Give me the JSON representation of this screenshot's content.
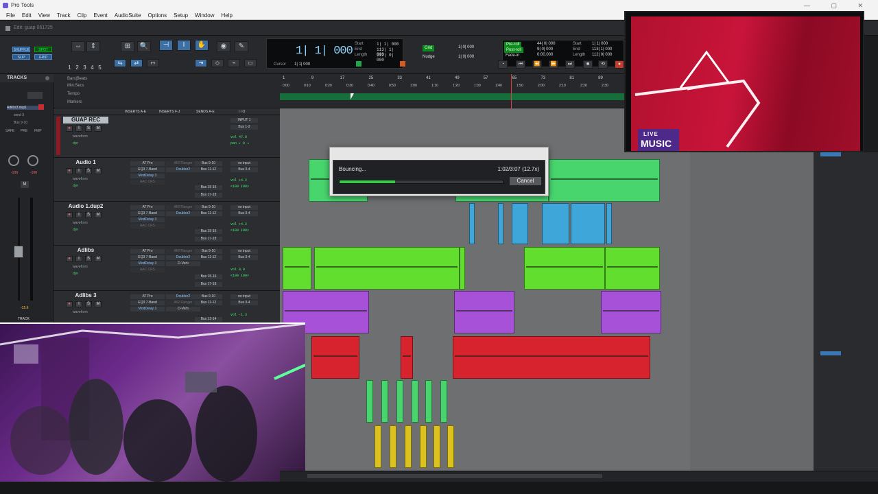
{
  "window": {
    "title": "Pro Tools",
    "doc_title": "Edit: guap 061725"
  },
  "menu": [
    "File",
    "Edit",
    "View",
    "Track",
    "Clip",
    "Event",
    "AudioSuite",
    "Options",
    "Setup",
    "Window",
    "Help"
  ],
  "toolbar": {
    "modes": [
      "SHUFFLE",
      "SPOT",
      "SLIP",
      "GRID"
    ],
    "zoom_presets": [
      "1",
      "2",
      "3",
      "4",
      "5"
    ],
    "counter": {
      "main": "1| 1| 000",
      "start_label": "Start",
      "end_label": "End",
      "length_label": "Length",
      "start": "1| 1| 000",
      "end": "113| 1| 000",
      "length": "112| 0| 000",
      "cursor_label": "Cursor",
      "cursor": "1| 1| 000"
    },
    "grid_label": "Grid",
    "grid": "1| 0| 000",
    "nudge_label": "Nudge",
    "nudge": "1| 0| 000",
    "preroll_label": "Pre-roll",
    "postroll_label": "Post-roll",
    "fadein_label": "Fade-in",
    "preroll": "44| 0| 000",
    "postroll": "9| 0| 000",
    "fadein": "0:00.000",
    "sel_start": "1| 1| 000",
    "sel_end": "113| 1| 000",
    "sel_length": "112| 0| 000"
  },
  "tracks_panel": {
    "header": "TRACKS",
    "item": "Adlibs3.dup1",
    "send": "send 3",
    "bus": "Bus 9-10",
    "safe": "SAFE",
    "pre": "PRE",
    "fmp": "FMP",
    "vol_a": "-100",
    "vol_b": "-100",
    "db": "-15.6",
    "track_btn": "TRACK",
    "m": "M"
  },
  "ruler": {
    "labels": [
      "Bars|Beats",
      "Min:Secs",
      "Tempo",
      "Markers"
    ],
    "bars": [
      "1",
      "9",
      "17",
      "25",
      "33",
      "41",
      "49",
      "57",
      "65",
      "73",
      "81",
      "89"
    ],
    "times": [
      "0:00",
      "0:10",
      "0:20",
      "0:30",
      "0:40",
      "0:50",
      "1:00",
      "1:10",
      "1:20",
      "1:30",
      "1:40",
      "1:50",
      "2:00",
      "2:10",
      "2:20",
      "2:30"
    ]
  },
  "mix_header": {
    "ins_ae": "INSERTS A-E",
    "ins_fj": "INSERTS F-J",
    "sends": "SENDS A-E",
    "io": "I / O"
  },
  "tracks": [
    {
      "name": "GUAP REC",
      "io_in": "INPUT 1",
      "io_out": "Bus 1-2",
      "vol": "vol  47.8",
      "pan": "pan ▸ 0 ◂",
      "view": "waveform",
      "dyn": "dyn"
    },
    {
      "name": "Audio 1",
      "inserts": [
        "AT Pro",
        "EQ3 7-Band",
        "ModDelay 3",
        "AAC CRS"
      ],
      "inserts2": [
        "AIR Flanger",
        "Doubler2"
      ],
      "sends": [
        "Bus 9-10",
        "Bus 11-12",
        "Bus 15-16",
        "Bus 17-18"
      ],
      "io_in": "no input",
      "io_out": "Bus 3-4",
      "vol": "vol  +4.2",
      "pan": "<100  100>"
    },
    {
      "name": "Audio 1.dup2",
      "inserts": [
        "AT Pro",
        "EQ3 7-Band",
        "ModDelay 3",
        "AAC CRS"
      ],
      "inserts2": [
        "AIR Flanger",
        "Doubler2"
      ],
      "sends": [
        "Bus 9-10",
        "Bus 11-12",
        "Bus 15-16",
        "Bus 17-18"
      ],
      "io_in": "no input",
      "io_out": "Bus 3-4",
      "vol": "vol  +4.2",
      "pan": "<100  100>"
    },
    {
      "name": "Adlibs",
      "inserts": [
        "AT Pro",
        "EQ3 7-Band",
        "ModDelay 3",
        "AAC CRS"
      ],
      "inserts2": [
        "AIR Flanger",
        "Doubler2",
        "D-Verb"
      ],
      "sends": [
        "Bus 9-10",
        "Bus 11-12",
        "Bus 15-16",
        "Bus 17-18"
      ],
      "io_in": "no input",
      "io_out": "Bus 3-4",
      "vol": "vol   0.0",
      "pan": "<100  100>"
    },
    {
      "name": "Adlibs 3",
      "inserts": [
        "AT Pro",
        "EQ3 7-Band",
        "ModDelay 3"
      ],
      "inserts2": [
        "Doubler2",
        "AIR Flanger",
        "D-Verb"
      ],
      "sends": [
        "Bus 9-10",
        "Bus 11-12",
        "Bus 13-14"
      ],
      "io_in": "no input",
      "io_out": "Bus 3-4",
      "vol": "vol  -1.3",
      "pan": "<100  100>"
    }
  ],
  "bounce": {
    "label": "Bouncing...",
    "time": "1:02/3:07 (12.7x)",
    "progress": 0.34,
    "cancel": "Cancel"
  },
  "overlay": {
    "live": "LIVE",
    "music": "MUSIC"
  },
  "colors": {
    "green": "#41d16a",
    "lime": "#62de2f",
    "purple": "#a651d8",
    "red": "#d6232e",
    "blue": "#3ea6d9",
    "yellow": "#dcc21d"
  }
}
